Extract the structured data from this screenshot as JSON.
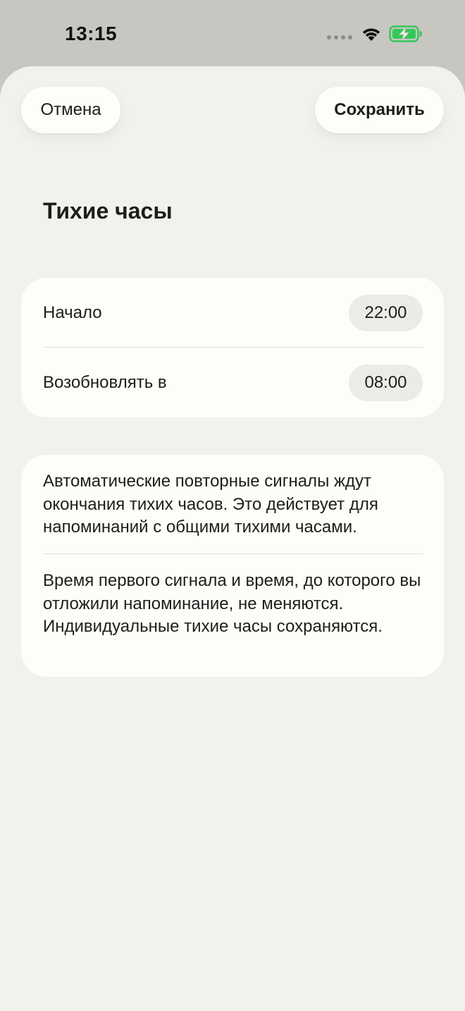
{
  "status_bar": {
    "time": "13:15",
    "icons": [
      "signal-dots-icon",
      "wifi-icon",
      "battery-charging-icon"
    ],
    "battery_color": "#34c759"
  },
  "header": {
    "cancel_label": "Отмена",
    "save_label": "Сохранить"
  },
  "page": {
    "title": "Тихие часы"
  },
  "schedule": {
    "rows": [
      {
        "label": "Начало",
        "value": "22:00"
      },
      {
        "label": "Возобновлять в",
        "value": "08:00"
      }
    ]
  },
  "info": {
    "paragraph_1": "Автоматические повторные сигналы ждут окончания тихих часов. Это действует для напоминаний с общими тихими часами.",
    "paragraph_2": "Время первого сигнала и время, до кото­рого вы отложили напоминание, не меняются. Индивидуальные тихие часы сохраняются."
  },
  "colors": {
    "sheet_background": "#f3f1ec",
    "card_background": "#fefdf9",
    "chip_background": "#ecebe6",
    "status_bar_background": "#c7c6c1"
  }
}
